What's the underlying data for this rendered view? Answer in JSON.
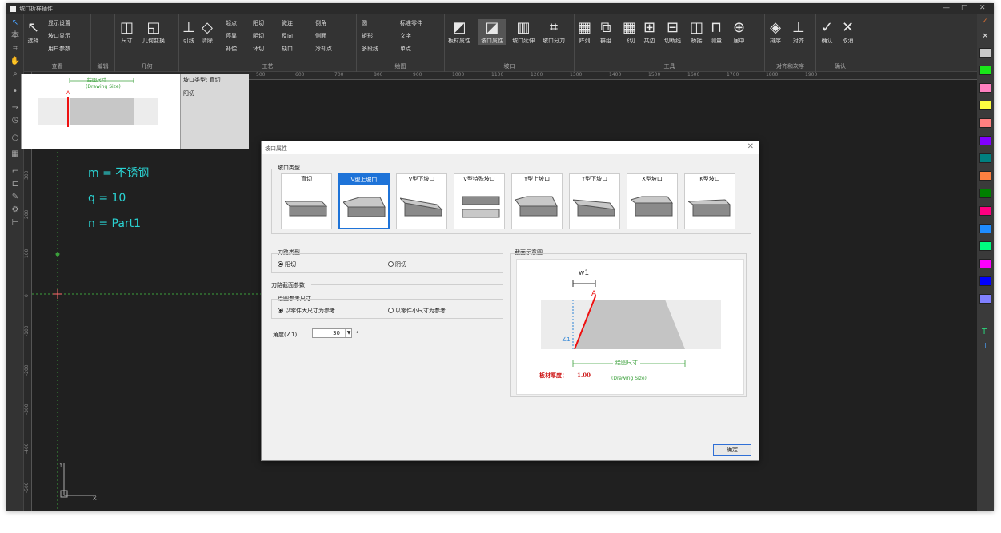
{
  "window": {
    "title": "坡口拆样插件",
    "controls": [
      "—",
      "□",
      "✕"
    ]
  },
  "ribbon": {
    "groups": [
      {
        "label": "查看",
        "items": [
          "选择",
          "显示设置",
          "坡口显示",
          "用户参数"
        ]
      },
      {
        "label": "编辑",
        "items": []
      },
      {
        "label": "几何",
        "items": [
          "尺寸",
          "几何变换"
        ]
      },
      {
        "label": "工艺",
        "items": [
          "引线",
          "清除",
          "起点",
          "阳切",
          "微连",
          "倒角",
          "停靠",
          "阴切",
          "反向",
          "侧面",
          "补偿",
          "环切",
          "缺口",
          "冷却点"
        ]
      },
      {
        "label": "绘图",
        "items": [
          "圆",
          "标准零件",
          "矩形",
          "文字",
          "多段线",
          "单点"
        ]
      },
      {
        "label": "坡口",
        "items": [
          "板材属性",
          "坡口属性",
          "坡口延伸",
          "坡口分刀"
        ]
      },
      {
        "label": "工具",
        "items": [
          "阵列",
          "群组",
          "飞切",
          "共边",
          "切断线",
          "桥接",
          "测量",
          "居中"
        ]
      },
      {
        "label": "对齐和次序",
        "items": [
          "排序",
          "对齐"
        ]
      },
      {
        "label": "确认",
        "items": [
          "确认",
          "取消"
        ]
      }
    ]
  },
  "ruler_labels": [
    "500",
    "600",
    "700",
    "800",
    "900",
    "1000",
    "1100",
    "1200",
    "1300",
    "1400",
    "1500",
    "1600",
    "1700",
    "1800",
    "1900"
  ],
  "vruler_labels": [
    "300",
    "200",
    "100",
    "0",
    "-100",
    "-200",
    "-300",
    "-400",
    "-500"
  ],
  "preview": {
    "size_label": "绘图尺寸",
    "size_label_en": "(Drawing Size)",
    "marker": "A",
    "right_title": "坡口类型: 直切",
    "right_sub": "阳切"
  },
  "canvas_text": {
    "m": "m = 不锈钢",
    "q": "q = 10",
    "n": "n = Part1",
    "axis_x": "X",
    "axis_y": "Y"
  },
  "dialog": {
    "title": "坡口属性",
    "bevel_type_label": "坡口类型",
    "bevels": [
      "直切",
      "V型上坡口",
      "V型下坡口",
      "V型特殊坡口",
      "Y型上坡口",
      "Y型下坡口",
      "X型坡口",
      "K型坡口"
    ],
    "selected_bevel": "V型上坡口",
    "cut_type_label": "刀路类型",
    "cut_yang": "阳切",
    "cut_yin": "阴切",
    "section_params_label": "刀路截面参数",
    "ref_size_label": "绘图参考尺寸",
    "ref_large": "以零件大尺寸为参考",
    "ref_small": "以零件小尺寸为参考",
    "angle_label": "角度(∠1):",
    "angle_value": "30",
    "angle_unit": "°",
    "schematic_label": "截面示意图",
    "schematic": {
      "w1": "w1",
      "A": "A",
      "angle": "∠1",
      "drawing_size": "绘图尺寸",
      "drawing_size_en": "(Drawing Size)",
      "thickness_label": "板材厚度：",
      "thickness_value": "1.00"
    },
    "ok": "确定"
  },
  "palette": [
    "#c8c8c8",
    "#19e619",
    "#ff80c0",
    "#ffff40",
    "#ff8080",
    "#8000ff",
    "#008080",
    "#ff8040",
    "#008000",
    "#ff0080",
    "#1e8cff",
    "#00ff80",
    "#ff00ff",
    "#0000ff",
    "#8080ff"
  ]
}
